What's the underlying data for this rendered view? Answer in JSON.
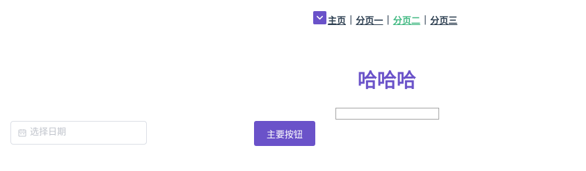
{
  "nav": {
    "items": [
      {
        "label": "主页",
        "active": false
      },
      {
        "label": "分页一",
        "active": false
      },
      {
        "label": "分页二",
        "active": true
      },
      {
        "label": "分页三",
        "active": false
      }
    ],
    "separator": "|",
    "toggle_icon": "chevron-down-icon"
  },
  "main": {
    "title": "哈哈哈",
    "input_value": ""
  },
  "date_picker": {
    "placeholder": "选择日期",
    "icon": "calendar-icon"
  },
  "primary_button": {
    "label": "主要按钮"
  },
  "colors": {
    "accent": "#6a52c9",
    "link": "#2c3e50",
    "active_link": "#42b983",
    "placeholder": "#c0c4cc",
    "border": "#dcdfe6"
  }
}
